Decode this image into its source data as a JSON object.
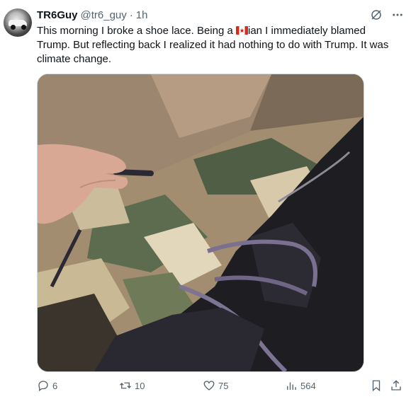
{
  "tweet": {
    "author_name": "TR6Guy",
    "handle": "@tr6_guy",
    "separator": "·",
    "time": "1h",
    "text_before_flag": "This morning I broke a shoe lace. Being a ",
    "flag_emoji": "canada-flag",
    "text_after_flag": "ian I immediately blamed Trump. But reflecting back I realized it had nothing to do with Trump. It was climate change."
  },
  "actions": {
    "replies": "6",
    "reposts": "10",
    "likes": "75",
    "views": "564"
  },
  "icons": {
    "grok": "grok-icon",
    "more": "more-icon",
    "reply": "reply-icon",
    "repost": "repost-icon",
    "like": "heart-icon",
    "views": "views-icon",
    "bookmark": "bookmark-icon",
    "share": "share-icon"
  },
  "colors": {
    "text": "#0f1419",
    "secondary": "#536471",
    "border": "#cfd9de"
  }
}
